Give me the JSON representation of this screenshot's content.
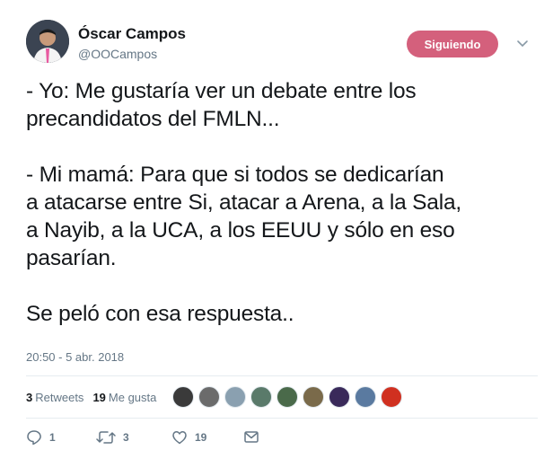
{
  "author": {
    "name": "Óscar Campos",
    "handle": "@OOCampos",
    "follow_label": "Siguiendo"
  },
  "tweet": {
    "lines": [
      "- Yo: Me gustaría ver un debate entre los",
      "precandidatos del FMLN...",
      "",
      "- Mi mamá: Para que si todos se dedicarían",
      "a atacarse entre Si, atacar a Arena, a la Sala,",
      "a Nayib, a la UCA, a los EEUU y sólo en eso",
      "pasarían.",
      "",
      "Se peló con esa respuesta.."
    ],
    "timestamp": "20:50 - 5 abr. 2018"
  },
  "stats": {
    "retweets_count": "3",
    "retweets_label": "Retweets",
    "likes_count": "19",
    "likes_label": "Me gusta",
    "liker_avatar_colors": [
      "#3a3a3a",
      "#6b6b6b",
      "#8aa0b0",
      "#5a7a6a",
      "#4a6a4a",
      "#7a6a4a",
      "#3a2a5a",
      "#5a7aa0",
      "#d03020"
    ]
  },
  "actions": {
    "reply_count": "1",
    "retweet_count": "3",
    "like_count": "19"
  },
  "colors": {
    "follow_button": "#d4607c",
    "secondary_text": "#657786"
  }
}
